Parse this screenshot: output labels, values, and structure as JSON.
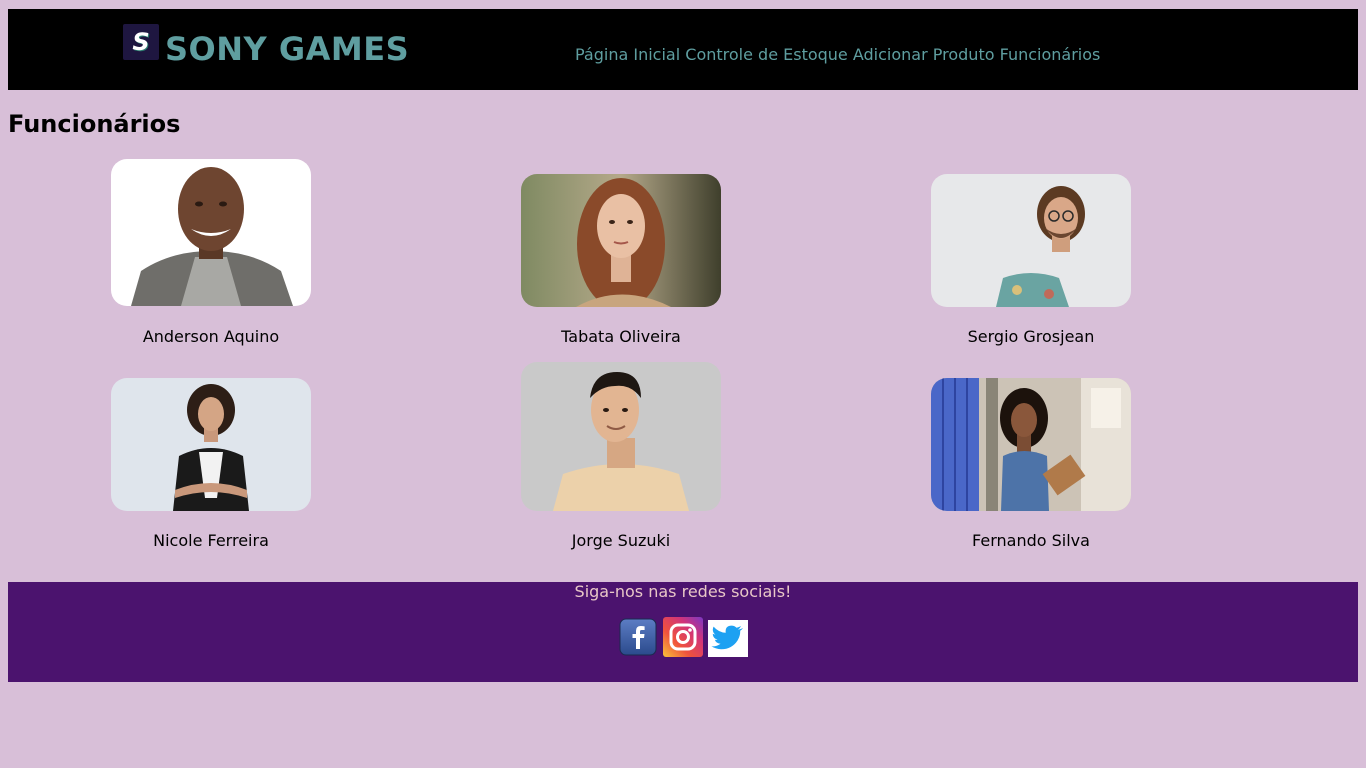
{
  "header": {
    "logo_letter": "S",
    "brand": "SONY GAMES",
    "nav": [
      {
        "label": "Página Inicial"
      },
      {
        "label": "Controle de Estoque"
      },
      {
        "label": "Adicionar Produto"
      },
      {
        "label": "Funcionários"
      }
    ]
  },
  "page_title": "Funcionários",
  "employees": [
    {
      "name": "Anderson Aquino"
    },
    {
      "name": "Tabata Oliveira"
    },
    {
      "name": "Sergio Grosjean"
    },
    {
      "name": "Nicole Ferreira"
    },
    {
      "name": "Jorge Suzuki"
    },
    {
      "name": "Fernando Silva"
    }
  ],
  "footer": {
    "text": "Siga-nos nas redes sociais!",
    "icons": [
      "facebook-icon",
      "instagram-icon",
      "twitter-icon"
    ]
  },
  "colors": {
    "page_bg": "#d8bfd8",
    "header_bg": "#000000",
    "accent": "#5f9ea0",
    "footer_bg": "#4b136e",
    "footer_text": "#e8c7c7"
  }
}
